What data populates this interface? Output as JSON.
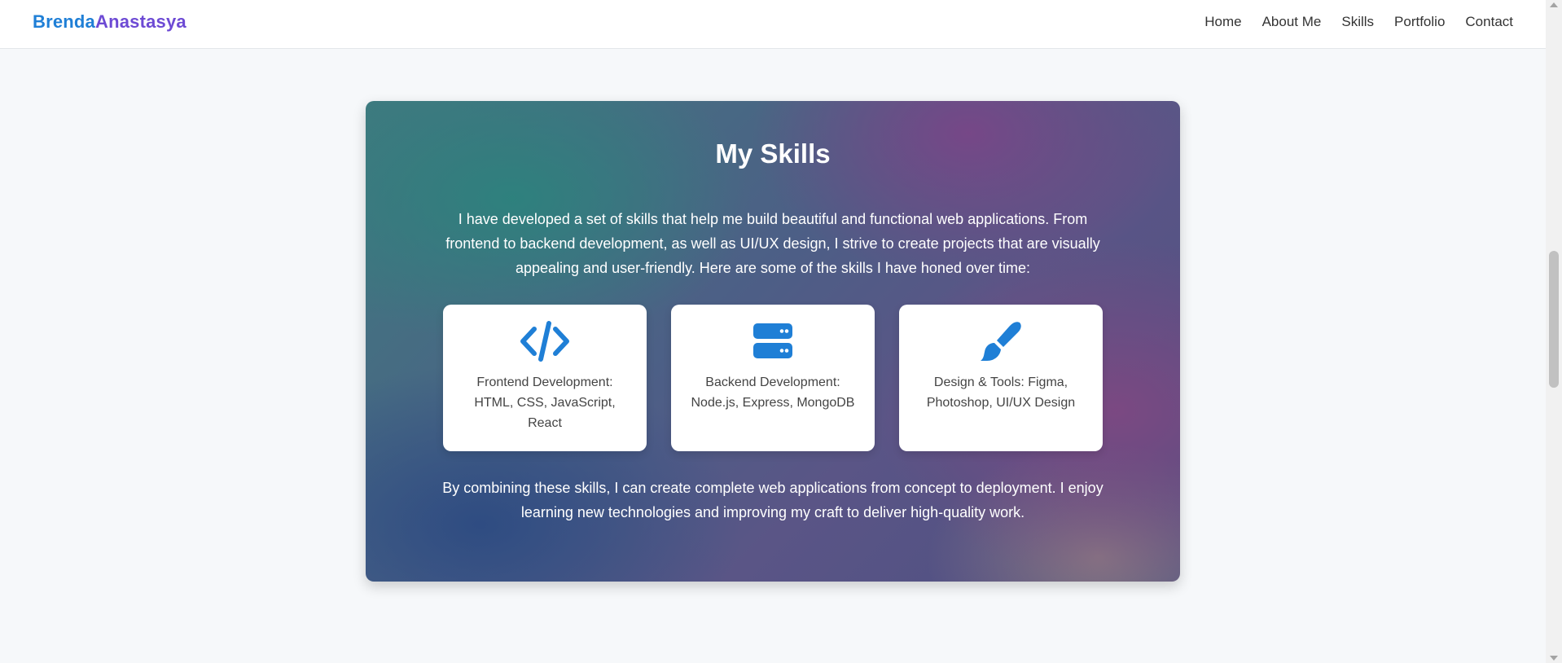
{
  "brand": {
    "first": "Brenda",
    "last": "Anastasya",
    "first_color": "#1f7fd6",
    "last_color": "#6d4ad4"
  },
  "nav": {
    "items": [
      "Home",
      "About Me",
      "Skills",
      "Portfolio",
      "Contact"
    ]
  },
  "skills": {
    "title": "My Skills",
    "intro": "I have developed a set of skills that help me build beautiful and functional web applications. From frontend to backend development, as well as UI/UX design, I strive to create projects that are visually appealing and user-friendly. Here are some of the skills I have honed over time:",
    "cards": [
      {
        "icon": "code-icon",
        "text": "Frontend Development: HTML, CSS, JavaScript, React"
      },
      {
        "icon": "server-icon",
        "text": "Backend Development: Node.js, Express, MongoDB"
      },
      {
        "icon": "paintbrush-icon",
        "text": "Design & Tools: Figma, Photoshop, UI/UX Design"
      }
    ],
    "outro": "By combining these skills, I can create complete web applications from concept to deployment. I enjoy learning new technologies and improving my craft to deliver high-quality work.",
    "icon_color": "#1f7fd6"
  }
}
